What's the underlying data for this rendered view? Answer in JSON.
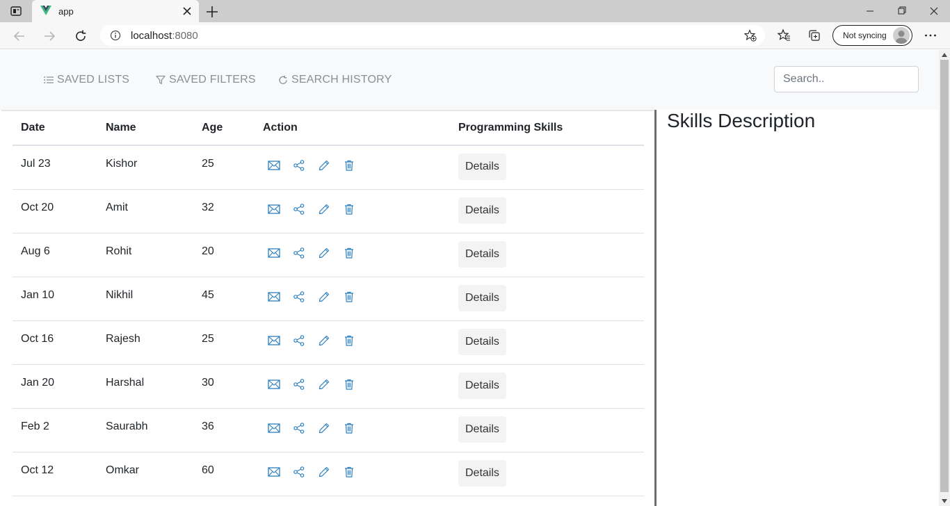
{
  "browser": {
    "tab_title": "app",
    "url_host": "localhost",
    "url_port": ":8080",
    "sync_label": "Not syncing"
  },
  "navbar": {
    "links": [
      {
        "label": "SAVED LISTS",
        "icon": "list-icon"
      },
      {
        "label": "SAVED FILTERS",
        "icon": "filter-icon"
      },
      {
        "label": "SEARCH HISTORY",
        "icon": "history-icon"
      }
    ],
    "search_placeholder": "Search.."
  },
  "table": {
    "headers": [
      "Date",
      "Name",
      "Age",
      "Action",
      "Programming Skills"
    ],
    "action_icons": [
      "mail-icon",
      "share-icon",
      "edit-icon",
      "delete-icon"
    ],
    "details_label": "Details",
    "rows": [
      {
        "date": "Jul 23",
        "name": "Kishor",
        "age": "25"
      },
      {
        "date": "Oct 20",
        "name": "Amit",
        "age": "32"
      },
      {
        "date": "Aug 6",
        "name": "Rohit",
        "age": "20"
      },
      {
        "date": "Jan 10",
        "name": "Nikhil",
        "age": "45"
      },
      {
        "date": "Oct 16",
        "name": "Rajesh",
        "age": "25"
      },
      {
        "date": "Jan 20",
        "name": "Harshal",
        "age": "30"
      },
      {
        "date": "Feb 2",
        "name": "Saurabh",
        "age": "36"
      },
      {
        "date": "Oct 12",
        "name": "Omkar",
        "age": "60"
      }
    ]
  },
  "skills_panel": {
    "title": "Skills Description"
  },
  "colors": {
    "accent": "#2a7fbf",
    "navbar_bg": "#f8f9fa",
    "nav_link": "#8a8f94",
    "divider": "#6d6d6d"
  }
}
